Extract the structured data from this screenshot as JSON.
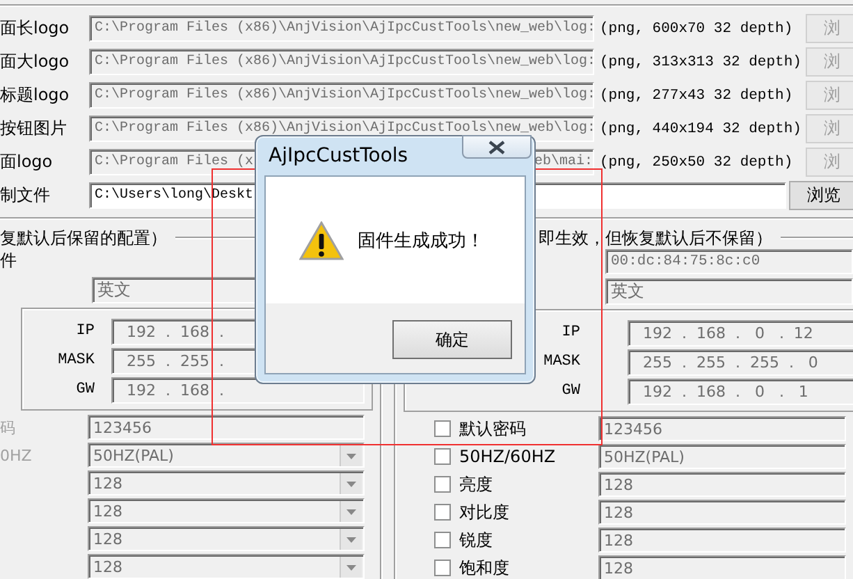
{
  "file_rows": [
    {
      "label": "面长logo",
      "value": "C:\\Program Files (x86)\\AnjVision\\AjIpcCustTools\\new_web\\log:",
      "info": "(png, 600x70 32 depth)",
      "button": "浏",
      "disabled": true
    },
    {
      "label": "面大logo",
      "value": "C:\\Program Files (x86)\\AnjVision\\AjIpcCustTools\\new_web\\log:",
      "info": "(png, 313x313 32 depth)",
      "button": "浏",
      "disabled": true
    },
    {
      "label": "标题logo",
      "value": "C:\\Program Files (x86)\\AnjVision\\AjIpcCustTools\\new_web\\log:",
      "info": "(png, 277x43 32 depth)",
      "button": "浏",
      "disabled": true
    },
    {
      "label": "按钮图片",
      "value": "C:\\Program Files (x86)\\AnjVision\\AjIpcCustTools\\new_web\\log:",
      "info": "(png, 440x194 32 depth)",
      "button": "浏",
      "disabled": true
    },
    {
      "label": "面logo",
      "value": "C:\\Program Files (x",
      "tail": "eb\\mai:",
      "info": "(png, 250x50 32 depth)",
      "button": "浏",
      "disabled": true
    },
    {
      "label": "制文件",
      "value": "C:\\Users\\long\\Deskt",
      "button": "浏览",
      "disabled": false
    }
  ],
  "left_group": {
    "title": "复默认后保留的配置）",
    "subtitle": "件",
    "language": "英文",
    "network": [
      {
        "label": "IP",
        "value": "192  .  168  ."
      },
      {
        "label": "MASK",
        "value": "255  .  255  ."
      },
      {
        "label": "GW",
        "value": "192  .  168  ."
      }
    ],
    "fields": [
      {
        "label": "码",
        "value": "123456",
        "kind": "text"
      },
      {
        "label": "0HZ",
        "value": "50HZ(PAL)",
        "kind": "combo"
      },
      {
        "value": "128",
        "kind": "combo"
      },
      {
        "value": "128",
        "kind": "combo"
      },
      {
        "value": "128",
        "kind": "combo"
      },
      {
        "value": "128",
        "kind": "combo"
      }
    ]
  },
  "right_group": {
    "title": "即生效，但恢复默认后不保留）",
    "mac": "00:dc:84:75:8c:c0",
    "language": "英文",
    "network": [
      {
        "label": "IP",
        "value": "192  .  168  .   0   .  12"
      },
      {
        "label": "MASK",
        "value": "255  .  255  .  255  .   0"
      },
      {
        "label": "GW",
        "value": "192  .  168  .   0   .   1"
      }
    ],
    "options": [
      {
        "label": "默认密码",
        "checked": false,
        "value": "123456"
      },
      {
        "label": "50HZ/60HZ",
        "checked": false,
        "value": "50HZ(PAL)"
      },
      {
        "label": "亮度",
        "checked": false,
        "value": "128"
      },
      {
        "label": "对比度",
        "checked": false,
        "value": "128"
      },
      {
        "label": "锐度",
        "checked": false,
        "value": "128"
      },
      {
        "label": "饱和度",
        "checked": false,
        "value": "128"
      }
    ]
  },
  "dialog": {
    "title": "AjIpcCustTools",
    "message": "固件生成成功！",
    "button": "确定"
  }
}
